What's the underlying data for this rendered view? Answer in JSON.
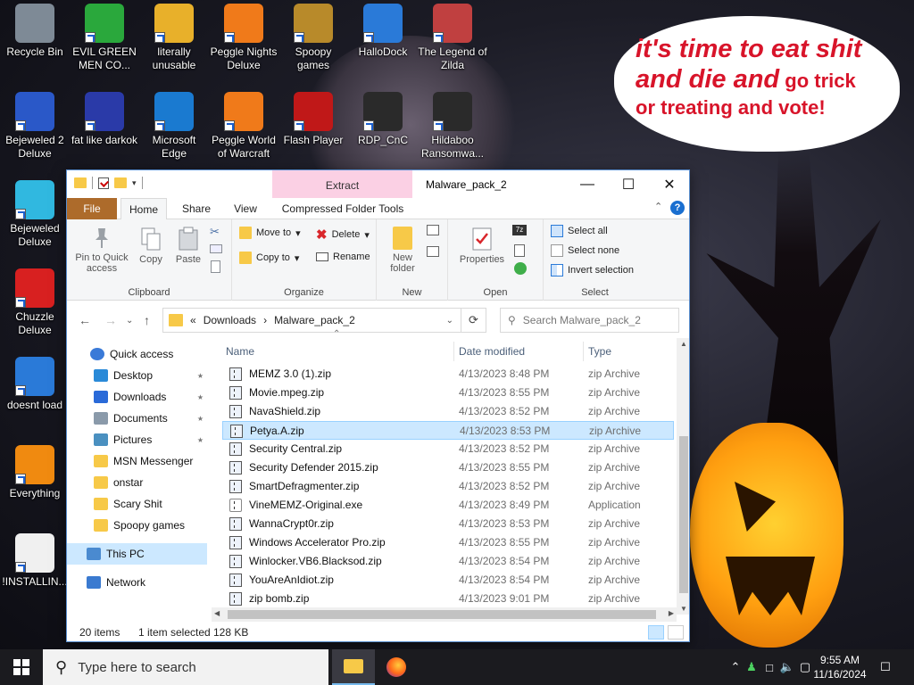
{
  "desktop": {
    "icons": [
      {
        "label": "Recycle Bin",
        "icon": "recycle-bin-icon"
      },
      {
        "label": "EVIL GREEN MEN CO...",
        "icon": "green-men-icon"
      },
      {
        "label": "literally unusable",
        "icon": "chrome-icon"
      },
      {
        "label": "Peggle Nights Deluxe",
        "icon": "peggle-icon"
      },
      {
        "label": "Spoopy games",
        "icon": "folder-icon"
      },
      {
        "label": "HalloDock",
        "icon": "windows-logo-icon"
      },
      {
        "label": "The Legend of Zilda",
        "icon": "zilda-icon"
      },
      {
        "label": "Bejeweled 2 Deluxe",
        "icon": "bejeweled-icon"
      },
      {
        "label": "fat like darkok",
        "icon": "mpl-icon"
      },
      {
        "label": "Microsoft Edge",
        "icon": "edge-icon"
      },
      {
        "label": "Peggle World of Warcraft",
        "icon": "peggle-wow-icon"
      },
      {
        "label": "Flash Player",
        "icon": "flash-icon"
      },
      {
        "label": "RDP_CnC",
        "icon": "rdp-icon"
      },
      {
        "label": "Hildaboo Ransomwa...",
        "icon": "yashma-icon"
      },
      {
        "label": "Bejeweled Deluxe",
        "icon": "diamond-icon"
      },
      {
        "label": "Chuzzle Deluxe",
        "icon": "chuzzle-icon"
      },
      {
        "label": "doesnt load",
        "icon": "thunderbird-icon"
      },
      {
        "label": "Everything",
        "icon": "everything-search-icon"
      },
      {
        "label": "!INSTALLIN...",
        "icon": "text-document-icon"
      }
    ],
    "bubble": {
      "line1a": "it's time to eat shit",
      "line2a": "and die and",
      "line2b": " go trick",
      "line3": "or treating and vote!"
    }
  },
  "window": {
    "extract_tab": "Extract",
    "title": "Malware_pack_2",
    "tabs": {
      "file": "File",
      "home": "Home",
      "share": "Share",
      "view": "View",
      "compressed": "Compressed Folder Tools"
    },
    "ribbon": {
      "pin": "Pin to Quick access",
      "copy": "Copy",
      "paste": "Paste",
      "clipboard": "Clipboard",
      "move_to": "Move to",
      "copy_to": "Copy to",
      "delete": "Delete",
      "rename": "Rename",
      "organize": "Organize",
      "new_folder": "New folder",
      "new": "New",
      "properties": "Properties",
      "open": "Open",
      "select_all": "Select all",
      "select_none": "Select none",
      "invert_selection": "Invert selection",
      "select": "Select"
    },
    "address": {
      "crumb_prefix": "«",
      "crumb1": "Downloads",
      "sep": "›",
      "crumb2": "Malware_pack_2",
      "search_placeholder": "Search Malware_pack_2"
    },
    "nav": [
      {
        "label": "Quick access",
        "icon": "star-icon",
        "pinned": false
      },
      {
        "label": "Desktop",
        "icon": "desktop-icon",
        "pinned": true
      },
      {
        "label": "Downloads",
        "icon": "download-icon",
        "pinned": true
      },
      {
        "label": "Documents",
        "icon": "documents-icon",
        "pinned": true
      },
      {
        "label": "Pictures",
        "icon": "pictures-icon",
        "pinned": true
      },
      {
        "label": "MSN Messenger",
        "icon": "folder-icon",
        "pinned": false
      },
      {
        "label": "onstar",
        "icon": "folder-icon",
        "pinned": false
      },
      {
        "label": "Scary Shit",
        "icon": "folder-icon",
        "pinned": false
      },
      {
        "label": "Spoopy games",
        "icon": "folder-icon",
        "pinned": false
      },
      {
        "label": "This PC",
        "icon": "computer-icon",
        "pinned": false
      },
      {
        "label": "Network",
        "icon": "network-icon",
        "pinned": false
      }
    ],
    "columns": {
      "name": "Name",
      "date": "Date modified",
      "type": "Type"
    },
    "files": [
      {
        "name": "MEMZ 3.0 (1).zip",
        "date": "4/13/2023 8:48 PM",
        "type": "zip Archive",
        "kind": "zip"
      },
      {
        "name": "Movie.mpeg.zip",
        "date": "4/13/2023 8:55 PM",
        "type": "zip Archive",
        "kind": "zip"
      },
      {
        "name": "NavaShield.zip",
        "date": "4/13/2023 8:52 PM",
        "type": "zip Archive",
        "kind": "zip"
      },
      {
        "name": "Petya.A.zip",
        "date": "4/13/2023 8:53 PM",
        "type": "zip Archive",
        "kind": "zip",
        "selected": true
      },
      {
        "name": "Security Central.zip",
        "date": "4/13/2023 8:52 PM",
        "type": "zip Archive",
        "kind": "zip"
      },
      {
        "name": "Security Defender 2015.zip",
        "date": "4/13/2023 8:55 PM",
        "type": "zip Archive",
        "kind": "zip"
      },
      {
        "name": "SmartDefragmenter.zip",
        "date": "4/13/2023 8:52 PM",
        "type": "zip Archive",
        "kind": "zip"
      },
      {
        "name": "VineMEMZ-Original.exe",
        "date": "4/13/2023 8:49 PM",
        "type": "Application",
        "kind": "exe"
      },
      {
        "name": "WannaCrypt0r.zip",
        "date": "4/13/2023 8:53 PM",
        "type": "zip Archive",
        "kind": "zip"
      },
      {
        "name": "Windows Accelerator Pro.zip",
        "date": "4/13/2023 8:55 PM",
        "type": "zip Archive",
        "kind": "zip"
      },
      {
        "name": "Winlocker.VB6.Blacksod.zip",
        "date": "4/13/2023 8:54 PM",
        "type": "zip Archive",
        "kind": "zip"
      },
      {
        "name": "YouAreAnIdiot.zip",
        "date": "4/13/2023 8:54 PM",
        "type": "zip Archive",
        "kind": "zip"
      },
      {
        "name": "zip bomb.zip",
        "date": "4/13/2023 9:01 PM",
        "type": "zip Archive",
        "kind": "zip"
      }
    ],
    "status": {
      "count": "20 items",
      "selected": "1 item selected",
      "size": "128 KB"
    }
  },
  "taskbar": {
    "search_placeholder": "Type here to search",
    "time": "9:55 AM",
    "date": "11/16/2024"
  },
  "colors": {
    "accent": "#1a5fd0",
    "file_tab": "#ad6b2b",
    "selection": "#cce8ff",
    "extract_tab": "#fbd0e4",
    "bubble_text": "#d8142a"
  }
}
